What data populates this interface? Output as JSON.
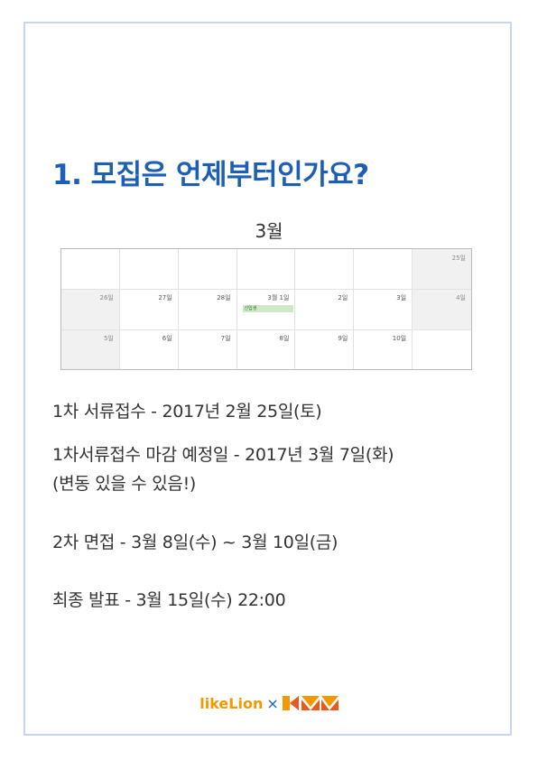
{
  "title": "1. 모집은 언제부터인가요?",
  "calendar": {
    "month": "3월",
    "rows": [
      [
        {
          "day": "",
          "shade": false
        },
        {
          "day": "",
          "shade": false
        },
        {
          "day": "",
          "shade": false
        },
        {
          "day": "",
          "shade": false
        },
        {
          "day": "",
          "shade": false
        },
        {
          "day": "",
          "shade": false
        },
        {
          "day": "25일",
          "shade": true
        }
      ],
      [
        {
          "day": "26일",
          "shade": true
        },
        {
          "day": "27일",
          "shade": false
        },
        {
          "day": "28일",
          "shade": false
        },
        {
          "day": "3월 1일",
          "shade": false
        },
        {
          "day": "2일",
          "shade": false
        },
        {
          "day": "3일",
          "shade": false
        },
        {
          "day": "4일",
          "shade": true
        }
      ],
      [
        {
          "day": "5일",
          "shade": true
        },
        {
          "day": "6일",
          "shade": false
        },
        {
          "day": "7일",
          "shade": false
        },
        {
          "day": "8일",
          "shade": false
        },
        {
          "day": "9일",
          "shade": false
        },
        {
          "day": "10일",
          "shade": false
        },
        {
          "day": "",
          "shade": false
        }
      ]
    ],
    "event": "신입생"
  },
  "info": {
    "line1": "1차 서류접수 - 2017년 2월 25일(토)",
    "line2": "1차서류접수 마감 예정일 - 2017년 3월 7일(화)",
    "line3": "(변동 있을 수 있음!)",
    "line4": "2차 면접 - 3월 8일(수) ~ 3월 10일(금)",
    "line5": "최종 발표 - 3월 15일(수) 22:00"
  },
  "footer": {
    "brand1": "likeLion",
    "separator": "×",
    "brand2_icon": "kmm-logo-icon"
  },
  "colors": {
    "title": "#1d5fb5",
    "likelion": "#f39800",
    "frame": "#c8d6ec"
  }
}
